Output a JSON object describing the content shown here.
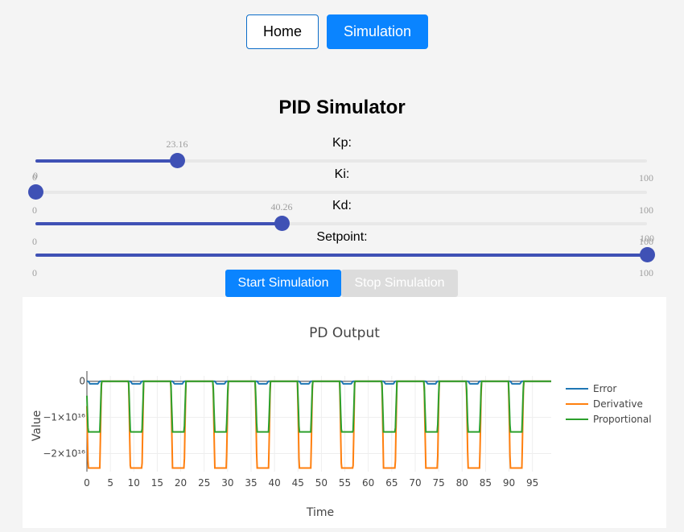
{
  "nav": {
    "home_label": "Home",
    "simulation_label": "Simulation"
  },
  "page_title": "PID Simulator",
  "sliders": [
    {
      "label": "Kp:",
      "value": 23.16,
      "value_text": "23.16",
      "min": "0",
      "max": "100"
    },
    {
      "label": "Ki:",
      "value": 0,
      "value_text": "0",
      "min": "0",
      "max": "100"
    },
    {
      "label": "Kd:",
      "value": 40.26,
      "value_text": "40.26",
      "min": "0",
      "max": "100"
    },
    {
      "label": "Setpoint:",
      "value": 100,
      "value_text": "100",
      "min": "0",
      "max": "100"
    }
  ],
  "controls": {
    "start_label": "Start Simulation",
    "stop_label": "Stop Simulation"
  },
  "colors": {
    "accent": "#0a84ff",
    "slider": "#3f51b5",
    "error": "#1f77b4",
    "derivative": "#ff7f0e",
    "proportional": "#2ca02c"
  },
  "chart_data": {
    "type": "line",
    "title": "PD Output",
    "xlabel": "Time",
    "ylabel": "Value",
    "x_ticks": [
      0,
      5,
      10,
      15,
      20,
      25,
      30,
      35,
      40,
      45,
      50,
      55,
      60,
      65,
      70,
      75,
      80,
      85,
      90,
      95
    ],
    "y_ticks": [
      0,
      -1e+16,
      -2e+16
    ],
    "y_tick_labels": [
      "0",
      "−1×10¹⁶",
      "−2×10¹⁶"
    ],
    "xlim": [
      0,
      99
    ],
    "ylim": [
      -2.5e+16,
      1500000000000000.0
    ],
    "grid": true,
    "legend": "right",
    "pulse_centers": [
      1.5,
      10.5,
      19.5,
      28.5,
      37.5,
      46.5,
      55.5,
      64.5,
      73.5,
      82.5,
      91.5
    ],
    "series": [
      {
        "name": "Error",
        "min_value": -700000000000000.0
      },
      {
        "name": "Derivative",
        "min_value": -2.4e+16
      },
      {
        "name": "Proportional",
        "min_value": -1.4e+16
      }
    ]
  }
}
